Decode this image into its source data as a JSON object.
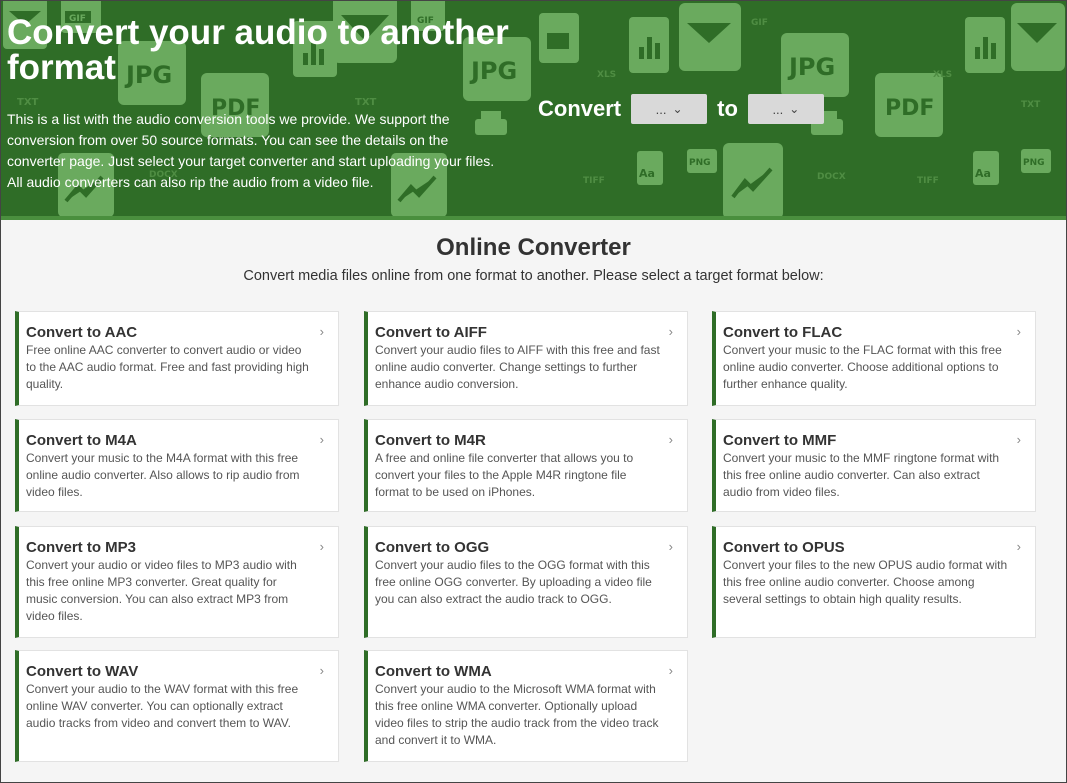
{
  "hero": {
    "title": "Convert your audio to another format",
    "description": "This is a list with the audio conversion tools we provide. We support the conversion from over 50 source formats. You can see the details on the converter page. Just select your target converter and start uploading your files. All audio converters can also rip the audio from a video file.",
    "convert_label": "Convert",
    "to_label": "to",
    "from_select": "...",
    "to_select": "..."
  },
  "main": {
    "title": "Online Converter",
    "subtitle": "Convert media files online from one format to another. Please select a target format below:"
  },
  "cards": [
    {
      "title": "Convert to AAC",
      "desc": "Free online AAC converter to convert audio or video to the AAC audio format. Free and fast providing high quality."
    },
    {
      "title": "Convert to AIFF",
      "desc": "Convert your audio files to AIFF with this free and fast online audio converter. Change settings to further enhance audio conversion."
    },
    {
      "title": "Convert to FLAC",
      "desc": "Convert your music to the FLAC format with this free online audio converter. Choose additional options to further enhance quality."
    },
    {
      "title": "Convert to M4A",
      "desc": "Convert your music to the M4A format with this free online audio converter. Also allows to rip audio from video files."
    },
    {
      "title": "Convert to M4R",
      "desc": "A free and online file converter that allows you to convert your files to the Apple M4R ringtone file format to be used on iPhones."
    },
    {
      "title": "Convert to MMF",
      "desc": "Convert your music to the MMF ringtone format with this free online audio converter. Can also extract audio from video files."
    },
    {
      "title": "Convert to MP3",
      "desc": "Convert your audio or video files to MP3 audio with this free online MP3 converter. Great quality for music conversion. You can also extract MP3 from video files."
    },
    {
      "title": "Convert to OGG",
      "desc": "Convert your audio files to the OGG format with this free online OGG converter. By uploading a video file you can also extract the audio track to OGG."
    },
    {
      "title": "Convert to OPUS",
      "desc": "Convert your files to the new OPUS audio format with this free online audio converter. Choose among several settings to obtain high quality results."
    },
    {
      "title": "Convert to WAV",
      "desc": "Convert your audio to the WAV format with this free online WAV converter. You can optionally extract audio tracks from video and convert them to WAV."
    },
    {
      "title": "Convert to WMA",
      "desc": "Convert your audio to the Microsoft WMA format with this free online WMA converter. Optionally upload video files to strip the audio track from the video track and convert it to WMA."
    }
  ],
  "icons": {
    "card_arrow": "chevron-right-icon",
    "select_arrow": "chevron-down-icon"
  },
  "colors": {
    "hero_bg": "#2f6d27",
    "accent": "#2f6d27",
    "icon_tint": "#6aaa5e"
  },
  "bg_labels": {
    "jpg": "JPG",
    "pdf": "PDF",
    "gif": "GIF",
    "xls": "XLS",
    "txt": "TXT",
    "png": "PNG",
    "tiff": "TIFF",
    "docx": "DOCX",
    "aa": "Aa"
  }
}
